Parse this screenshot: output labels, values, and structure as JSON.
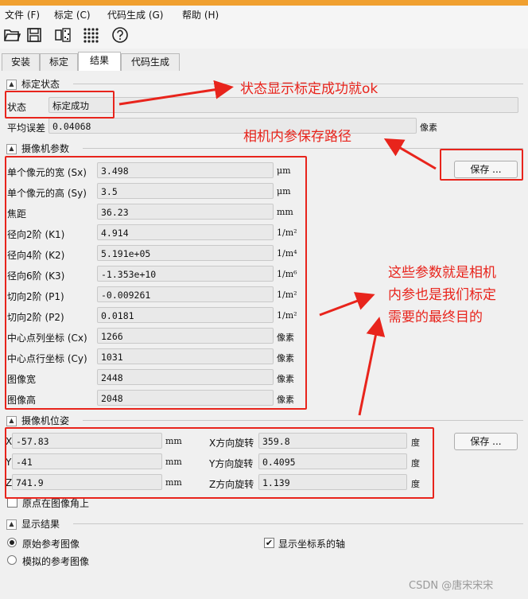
{
  "menu": [
    "文件 (F)",
    "标定 (C)",
    "代码生成 (G)",
    "帮助 (H)"
  ],
  "tabs": [
    "安装",
    "标定",
    "结果",
    "代码生成"
  ],
  "status_section": {
    "title": "标定状态",
    "status_label": "状态",
    "status_value": "标定成功",
    "mean_error_label": "平均误差",
    "mean_error_value": "0.04068",
    "mean_error_unit": "像素"
  },
  "camera_params": {
    "title": "摄像机参数",
    "save_button": "保存 ...",
    "rows": [
      {
        "label": "单个像元的宽 (Sx)",
        "value": "3.498",
        "unit": "μm"
      },
      {
        "label": "单个像元的高 (Sy)",
        "value": "3.5",
        "unit": "μm"
      },
      {
        "label": "焦距",
        "value": "36.23",
        "unit": "mm"
      },
      {
        "label": "径向2阶 (K1)",
        "value": "4.914",
        "unit": "1/m²"
      },
      {
        "label": "径向4阶 (K2)",
        "value": "5.191e+05",
        "unit": "1/m⁴"
      },
      {
        "label": "径向6阶 (K3)",
        "value": "-1.353e+10",
        "unit": "1/m⁶"
      },
      {
        "label": "切向2阶 (P1)",
        "value": "-0.009261",
        "unit": "1/m²"
      },
      {
        "label": "切向2阶 (P2)",
        "value": "0.0181",
        "unit": "1/m²"
      },
      {
        "label": "中心点列坐标 (Cx)",
        "value": "1266",
        "unit": "像素"
      },
      {
        "label": "中心点行坐标 (Cy)",
        "value": "1031",
        "unit": "像素"
      },
      {
        "label": "图像宽",
        "value": "2448",
        "unit": "像素"
      },
      {
        "label": "图像高",
        "value": "2048",
        "unit": "像素"
      }
    ]
  },
  "camera_pose": {
    "title": "摄像机位姿",
    "save_button": "保存 ...",
    "rows": [
      {
        "label": "X",
        "value": "-57.83",
        "unit": "mm",
        "rot_label": "X方向旋转",
        "rot_value": "359.8",
        "rot_unit": "度"
      },
      {
        "label": "Y",
        "value": "-41",
        "unit": "mm",
        "rot_label": "Y方向旋转",
        "rot_value": "0.4095",
        "rot_unit": "度"
      },
      {
        "label": "Z",
        "value": "741.9",
        "unit": "mm",
        "rot_label": "Z方向旋转",
        "rot_value": "1.139",
        "rot_unit": "度"
      }
    ],
    "origin_checkbox": "原点在图像角上"
  },
  "display": {
    "title": "显示结果",
    "radio_original": "原始参考图像",
    "radio_simulated": "模拟的参考图像",
    "show_axes": "显示坐标系的轴"
  },
  "annotations": {
    "status_note": "状态显示标定成功就ok",
    "save_path_note": "相机内参保存路径",
    "params_note_line1": "这些参数就是相机",
    "params_note_line2": "内参也是我们标定",
    "params_note_line3": "需要的最终目的"
  },
  "watermark": "CSDN @唐宋宋宋",
  "colors": {
    "annotation_red": "#e8241c",
    "field_bg": "#e9e9e9",
    "panel_bg": "#f0f0f0"
  }
}
